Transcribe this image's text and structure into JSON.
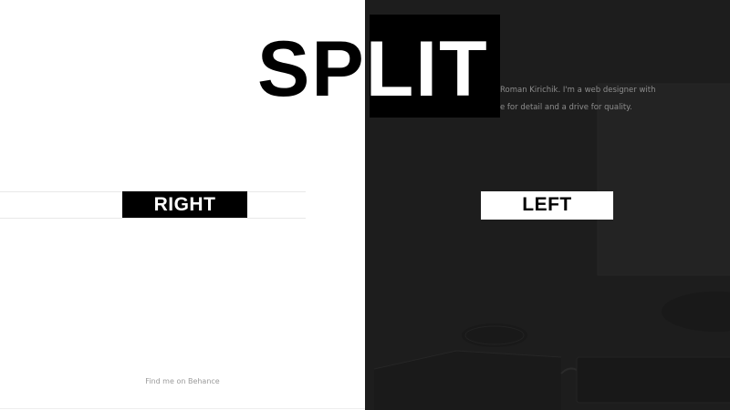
{
  "title": {
    "part1": "SP",
    "part2": "LIT"
  },
  "left_panel": {
    "button_label": "RIGHT",
    "footer_link": "Find me on Behance"
  },
  "right_panel": {
    "button_label": "LEFT",
    "intro_line1": "Roman Kirichik. I'm a web designer with",
    "intro_line2": "e for detail and a drive for quality."
  },
  "colors": {
    "light_panel": "#ffffff",
    "dark_panel": "#1e1e1e",
    "accent_black": "#000000",
    "muted_text": "#9a9a9a"
  }
}
